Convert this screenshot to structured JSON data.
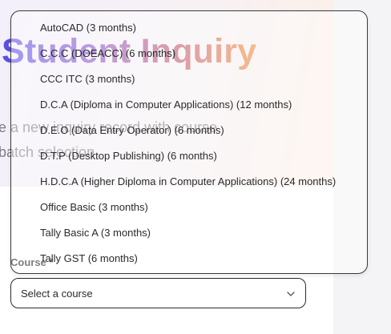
{
  "page": {
    "title": "Student Inquiry",
    "subtitle": "e a new inquiry record with course batch selection"
  },
  "form": {
    "course_label": "Course *",
    "course_placeholder": "Select a course"
  },
  "dropdown": {
    "options": [
      "AutoCAD (3 months)",
      "C.C.C (DOEACC) (6 months)",
      "CCC ITC (3 months)",
      "D.C.A (Diploma in Computer Applications) (12 months)",
      "D.E.O (Data Entry Operator) (6 months)",
      "D.T.P (Desktop Publishing) (6 months)",
      "H.D.C.A (Higher Diploma in Computer Applications) (24 months)",
      "Office Basic (3 months)",
      "Tally Basic A (3 months)",
      "Tally GST (6 months)"
    ]
  },
  "icons": {
    "select_chevron": "chevron-down-icon"
  },
  "colors": {
    "title_gradient_start": "#5b4fe6",
    "title_gradient_end": "#f08a3a",
    "border": "#2a2a2a"
  }
}
